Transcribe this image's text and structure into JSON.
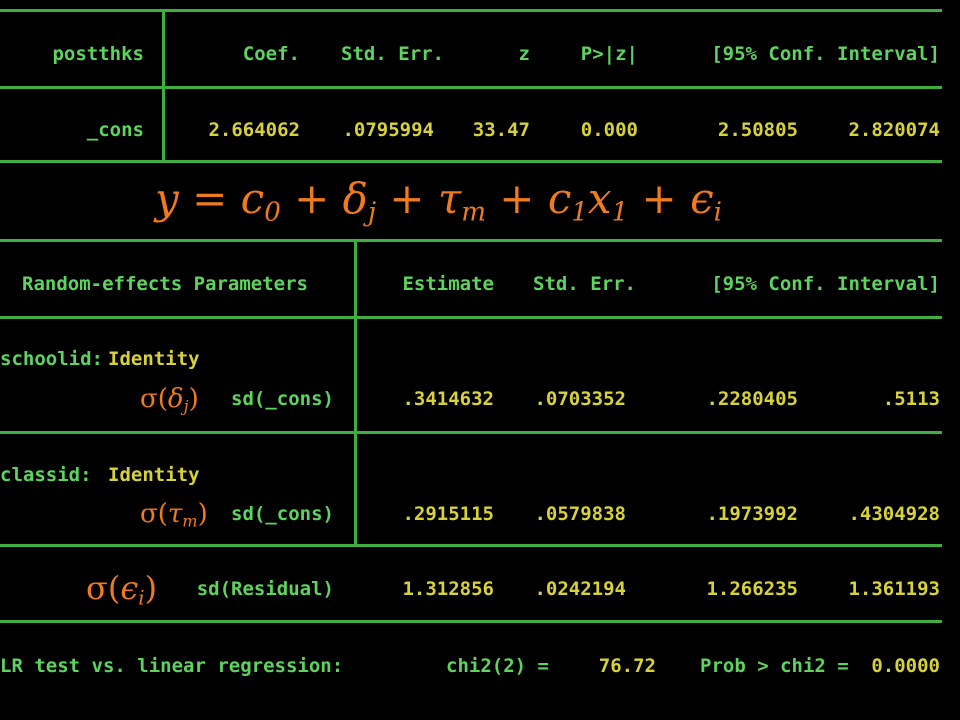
{
  "fixed_table": {
    "headers": {
      "var": "postthks",
      "coef": "Coef.",
      "se": "Std. Err.",
      "z": "z",
      "p": "P>|z|",
      "ci": "[95% Conf. Interval]"
    },
    "row": {
      "var": "_cons",
      "coef": "2.664062",
      "se": ".0795994",
      "z": "33.47",
      "p": "0.000",
      "ci_low": "2.50805",
      "ci_high": "2.820074"
    }
  },
  "equation": {
    "y": "y",
    "eq": "=",
    "c": "c",
    "c0_sub": "0",
    "plus": "+",
    "delta": "δ",
    "delta_sub": "j",
    "tau": "τ",
    "tau_sub": "m",
    "c1_sub": "1",
    "x": "x",
    "x1_sub": "1",
    "eps": "ϵ",
    "eps_sub": "i"
  },
  "random_table": {
    "headers": {
      "param": "Random-effects Parameters",
      "estimate": "Estimate",
      "se": "Std. Err.",
      "ci": "[95% Conf. Interval]"
    },
    "school": {
      "level": "schoolid:",
      "type": "Identity",
      "annot_sigma": "σ",
      "annot_var": "δ",
      "annot_sub": "j",
      "label": "sd(_cons)",
      "estimate": ".3414632",
      "se": ".0703352",
      "ci_low": ".2280405",
      "ci_high": ".5113"
    },
    "class": {
      "level": "classid:",
      "type": "Identity",
      "annot_sigma": "σ",
      "annot_var": "τ",
      "annot_sub": "m",
      "label": "sd(_cons)",
      "estimate": ".2915115",
      "se": ".0579838",
      "ci_low": ".1973992",
      "ci_high": ".4304928"
    },
    "residual": {
      "annot_sigma": "σ",
      "annot_var": "ϵ",
      "annot_sub": "i",
      "label": "sd(Residual)",
      "estimate": "1.312856",
      "se": ".0242194",
      "ci_low": "1.266235",
      "ci_high": "1.361193"
    }
  },
  "lr_test": {
    "label": "LR test vs. linear regression:",
    "chi_label": "chi2(2) =",
    "chi_value": "76.72",
    "prob_label": "Prob > chi2 =",
    "prob_value": "0.0000"
  },
  "colors": {
    "green_text": "#5fd35f",
    "yellow_text": "#d8d23a",
    "rule": "#3fae3f",
    "equation": "#f07a1e",
    "background": "#000000"
  }
}
